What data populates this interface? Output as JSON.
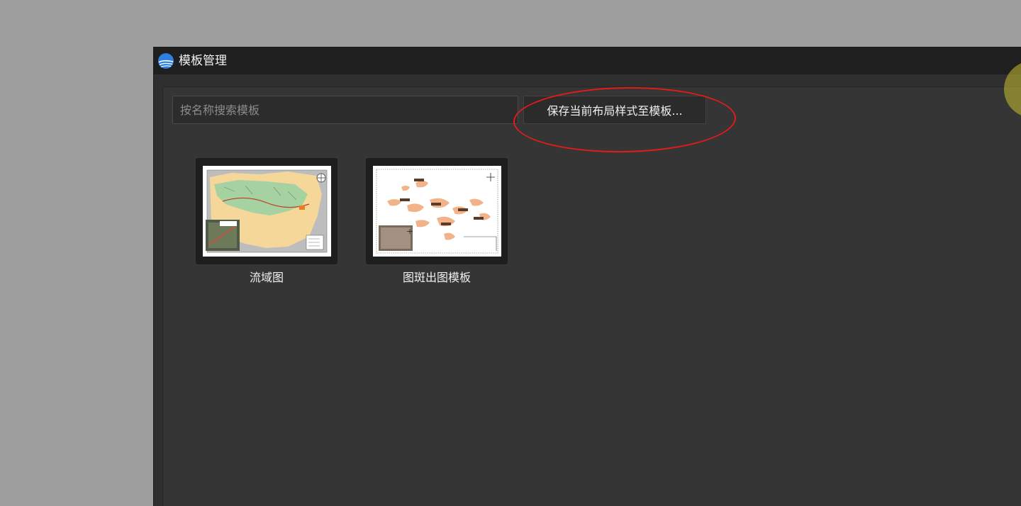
{
  "window": {
    "title": "模板管理",
    "logo_icon": "app-logo-icon"
  },
  "toolbar": {
    "search_placeholder": "按名称搜索模板",
    "search_value": "",
    "save_label": "保存当前布局样式至模板..."
  },
  "templates": [
    {
      "name": "流域图",
      "thumbnail": "watershed-map-thumbnail"
    },
    {
      "name": "图斑出图模板",
      "thumbnail": "patch-map-thumbnail"
    }
  ],
  "colors": {
    "annotation": "#e31b1b",
    "cursor_highlight": "#c9be30",
    "window_bg": "#353535",
    "titlebar_bg": "#1f1f1f"
  }
}
